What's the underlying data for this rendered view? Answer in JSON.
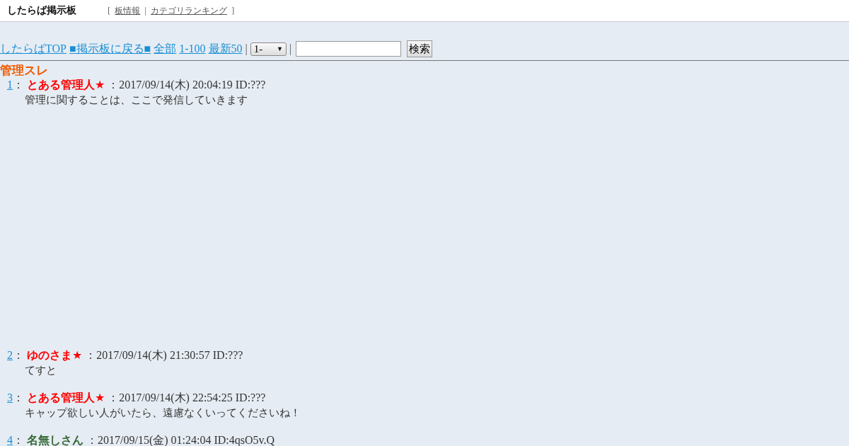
{
  "header": {
    "logo": "したらば掲示板",
    "open_bracket": "[",
    "links": [
      "板情報",
      "カテゴリランキング"
    ],
    "separator": "|",
    "close_bracket": "]"
  },
  "nav": {
    "links": [
      "したらばTOP",
      "■掲示板に戻る■",
      "全部",
      "1-100",
      "最新50"
    ],
    "separator_1": "|",
    "range_select": "1-",
    "select_caret": "▼",
    "separator_2": "|",
    "search_button": "検索"
  },
  "thread": {
    "title": "管理スレ"
  },
  "posts": [
    {
      "number": "1",
      "colon": "：",
      "name": "とある管理人★",
      "color": "#ff0000",
      "meta": "：2017/09/14(木) 20:04:19 ID:???",
      "body": "管理に関することは、ここで発信していきます",
      "kind": "with_ad_space"
    },
    {
      "number": "2",
      "colon": "：",
      "name": "ゆのさま★",
      "color": "#ff0000",
      "meta": "：2017/09/14(木) 21:30:57 ID:???",
      "body": "てすと",
      "kind": "normal"
    },
    {
      "number": "3",
      "colon": "：",
      "name": "とある管理人★",
      "color": "#ff0000",
      "meta": "：2017/09/14(木) 22:54:25 ID:???",
      "body": "キャップ欲しい人がいたら、遠慮なくいってくださいね！",
      "kind": "normal"
    },
    {
      "number": "4",
      "colon": "：",
      "name": "名無しさん",
      "color": "#336633",
      "meta": "：2017/09/15(金) 01:24:04 ID:4qsO5v.Q",
      "kind": "normal"
    }
  ]
}
